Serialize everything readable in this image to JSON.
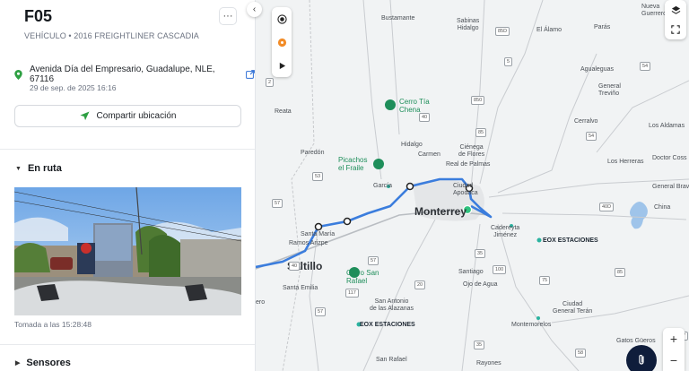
{
  "vehicle": {
    "name": "F05",
    "subtitle": "VEHÍCULO • 2016 FREIGHTLINER CASCADIA",
    "more_label": "···"
  },
  "location": {
    "address": "Avenida Día del Empresario, Guadalupe, NLE, 67116",
    "timestamp": "29 de sep. de 2025 16:16"
  },
  "share_button": {
    "label": "Compartir ubicación"
  },
  "sections": {
    "route_label": "En ruta",
    "photo_caption": "Tomada a las 15:28:48",
    "sensors_label": "Sensores"
  },
  "map": {
    "collapse_icon": "‹",
    "labels": {
      "bustamante": "Bustamante",
      "sabinas": "Sabinas\nHidalgo",
      "paras": "Parás",
      "el_alamo": "El Álamo",
      "nueva_guerrero": "Nueva\nGuerrero",
      "agualeguas": "Agualeguas",
      "general_trevino": "General\nTreviño",
      "cerralvo": "Cerralvo",
      "los_aldamas": "Los Aldamas",
      "reata": "Reata",
      "cerro_tia_chena": "Cerro Tía\nChena",
      "hidalgo": "Hidalgo",
      "cienega": "Ciénega\nde Flores",
      "carmen": "Carmen",
      "real_de_palmas": "Real de Palmas",
      "los_herreras": "Los Herreras",
      "doctor_coss": "Doctor Coss",
      "paredon": "Paredón",
      "picachos": "Picachos\nel Fraile",
      "garcia": "García",
      "ciudad_apodaca": "Ciudad\nApodaca",
      "general_bravo": "General Bravo",
      "china": "China",
      "monterrey": "Monterrey",
      "santa_maria": "Santa María",
      "ramos_arizpe": "Ramos Arizpe",
      "cadereyta": "Cadereyta\nJiménez",
      "eox1": "EOX ESTACIONES",
      "saltillo": "Saltillo",
      "cerro_san_rafael": "Cerro San\nRafael",
      "santiago": "Santiago",
      "ojo_de_agua": "Ojo de Agua",
      "santa_emilia": "Santa Emilia",
      "san_antonio": "San Antonio\nde las Alazanas",
      "ciudad_allende": "Ciudad\nde Allende",
      "ciudad_general_teran": "Ciudad\nGeneral Terán",
      "eox2": "EOX ESTACIONES",
      "montemorelos": "Montemorelos",
      "gatos_gueros": "Gatos Güeros",
      "san_rafael": "San Rafael",
      "rayones": "Rayones",
      "arteaga_part": "ero"
    },
    "shields": [
      "53",
      "1",
      "2",
      "85D",
      "5",
      "54",
      "850",
      "40",
      "85",
      "54",
      "40D",
      "53",
      "57",
      "40",
      "53",
      "35",
      "100",
      "85",
      "57",
      "75",
      "20",
      "117",
      "57",
      "31",
      "35",
      "58",
      "97"
    ],
    "zoom_in": "+",
    "zoom_out": "−"
  },
  "colors": {
    "route": "#3b7ddd",
    "park": "#1e8e5a",
    "accent_green": "#2ea043",
    "water": "#9fc4ea"
  }
}
